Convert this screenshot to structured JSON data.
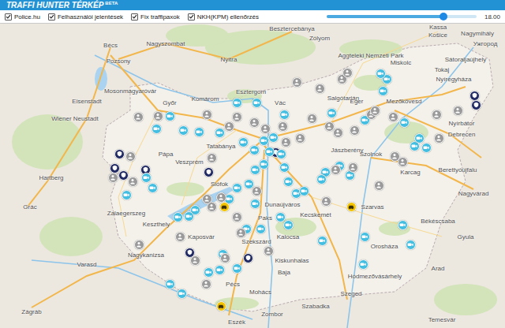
{
  "header": {
    "title": "TRAFFI HUNTER TÉRKÉP",
    "badge": "BETA"
  },
  "filters": [
    {
      "label": "Police.hu",
      "checked": true
    },
    {
      "label": "Felhasználói jelentések",
      "checked": true
    },
    {
      "label": "Fix traffipaxok",
      "checked": true
    },
    {
      "label": "NKH(KPM) ellenőrzés",
      "checked": true
    }
  ],
  "time_slider": {
    "level": 0.78,
    "reading": "18.00"
  },
  "map": {
    "labels": [
      "Besztercebánya",
      "Kassa",
      "Košice",
      "Nagymihály",
      "Ужгород",
      "Zólyom",
      "Nagyszombat",
      "Bécs",
      "Pozsony",
      "Nyitra",
      "Aggteleki Nemzeti Park",
      "Sátoraljaújhely",
      "Tokaj",
      "Miskolc",
      "Nyíregyháza",
      "Salgótarján",
      "Eger",
      "Mezőkövesd",
      "Nyírbátor",
      "Debrecen",
      "Esztergom",
      "Vác",
      "Komárom",
      "Győr",
      "Mosonmagyaróvár",
      "Eisenstadt",
      "Wiener Neustadt",
      "Tatabánya",
      "Jászberény",
      "Szolnok",
      "Karcag",
      "Berettyóújfalu",
      "Nagyvárad",
      "Pápa",
      "Veszprém",
      "Siófok",
      "Hartberg",
      "Grác",
      "Zalaegerszeg",
      "Keszthely",
      "Dunaújváros",
      "Szarvas",
      "Kecskemét",
      "Paks",
      "Békéscsaba",
      "Kaposvár",
      "Kalocsa",
      "Gyula",
      "Szekszárd",
      "Orosháza",
      "Nagykanizsa",
      "Kiskunhalas",
      "Varasd",
      "Arad",
      "Baja",
      "Hódmezővásárhely",
      "Pécs",
      "Mohács",
      "Szeged",
      "Szabadka",
      "Zágráb",
      "Zombor",
      "Temesvár",
      "Eszék"
    ],
    "markers": [
      {
        "kind": "police"
      },
      {
        "kind": "police"
      },
      {
        "kind": "police"
      },
      {
        "kind": "police"
      },
      {
        "kind": "police"
      },
      {
        "kind": "police"
      },
      {
        "kind": "police"
      },
      {
        "kind": "police"
      },
      {
        "kind": "police"
      },
      {
        "kind": "police"
      },
      {
        "kind": "fixed"
      },
      {
        "kind": "fixed"
      },
      {
        "kind": "fixed"
      },
      {
        "kind": "fixed"
      },
      {
        "kind": "fixed"
      },
      {
        "kind": "fixed"
      },
      {
        "kind": "fixed"
      },
      {
        "kind": "fixed"
      },
      {
        "kind": "fixed"
      },
      {
        "kind": "fixed"
      },
      {
        "kind": "fixed"
      },
      {
        "kind": "fixed"
      },
      {
        "kind": "fixed"
      },
      {
        "kind": "fixed"
      },
      {
        "kind": "fixed"
      },
      {
        "kind": "fixed"
      },
      {
        "kind": "fixed"
      },
      {
        "kind": "fixed"
      },
      {
        "kind": "fixed"
      },
      {
        "kind": "fixed"
      },
      {
        "kind": "fixed"
      },
      {
        "kind": "fixed"
      },
      {
        "kind": "fixed"
      },
      {
        "kind": "fixed"
      },
      {
        "kind": "fixed"
      },
      {
        "kind": "fixed"
      },
      {
        "kind": "fixed"
      },
      {
        "kind": "fixed"
      },
      {
        "kind": "fixed"
      },
      {
        "kind": "fixed"
      },
      {
        "kind": "fixed"
      },
      {
        "kind": "fixed"
      },
      {
        "kind": "fixed"
      },
      {
        "kind": "fixed"
      },
      {
        "kind": "fixed"
      },
      {
        "kind": "fixed"
      },
      {
        "kind": "fixed"
      },
      {
        "kind": "fixed"
      },
      {
        "kind": "fixed"
      },
      {
        "kind": "fixed"
      },
      {
        "kind": "fixed"
      },
      {
        "kind": "fixed"
      },
      {
        "kind": "fixed"
      },
      {
        "kind": "fixed"
      },
      {
        "kind": "fixed"
      },
      {
        "kind": "fixed"
      },
      {
        "kind": "fixed"
      },
      {
        "kind": "fixed"
      },
      {
        "kind": "fixed"
      },
      {
        "kind": "fixed"
      },
      {
        "kind": "fixed"
      },
      {
        "kind": "fixed"
      },
      {
        "kind": "fixed"
      },
      {
        "kind": "fixed"
      },
      {
        "kind": "fixed"
      },
      {
        "kind": "fixed"
      },
      {
        "kind": "fixed"
      },
      {
        "kind": "fixed"
      },
      {
        "kind": "user"
      },
      {
        "kind": "user"
      },
      {
        "kind": "user"
      },
      {
        "kind": "user"
      },
      {
        "kind": "user"
      },
      {
        "kind": "user"
      },
      {
        "kind": "user"
      },
      {
        "kind": "user"
      },
      {
        "kind": "user"
      },
      {
        "kind": "user"
      },
      {
        "kind": "user"
      },
      {
        "kind": "user"
      },
      {
        "kind": "user"
      },
      {
        "kind": "user"
      },
      {
        "kind": "user"
      },
      {
        "kind": "user"
      },
      {
        "kind": "user"
      },
      {
        "kind": "user"
      },
      {
        "kind": "user"
      },
      {
        "kind": "user"
      },
      {
        "kind": "user"
      },
      {
        "kind": "user"
      },
      {
        "kind": "user"
      },
      {
        "kind": "user"
      },
      {
        "kind": "user"
      },
      {
        "kind": "user"
      },
      {
        "kind": "user"
      },
      {
        "kind": "user"
      },
      {
        "kind": "user"
      },
      {
        "kind": "user"
      },
      {
        "kind": "user"
      },
      {
        "kind": "user"
      },
      {
        "kind": "user"
      },
      {
        "kind": "user"
      },
      {
        "kind": "user"
      },
      {
        "kind": "user"
      },
      {
        "kind": "user"
      },
      {
        "kind": "user"
      },
      {
        "kind": "user"
      },
      {
        "kind": "user"
      },
      {
        "kind": "user"
      },
      {
        "kind": "user"
      },
      {
        "kind": "user"
      },
      {
        "kind": "user"
      },
      {
        "kind": "user"
      },
      {
        "kind": "user"
      },
      {
        "kind": "nkh"
      },
      {
        "kind": "nkh"
      },
      {
        "kind": "nkh"
      }
    ]
  }
}
